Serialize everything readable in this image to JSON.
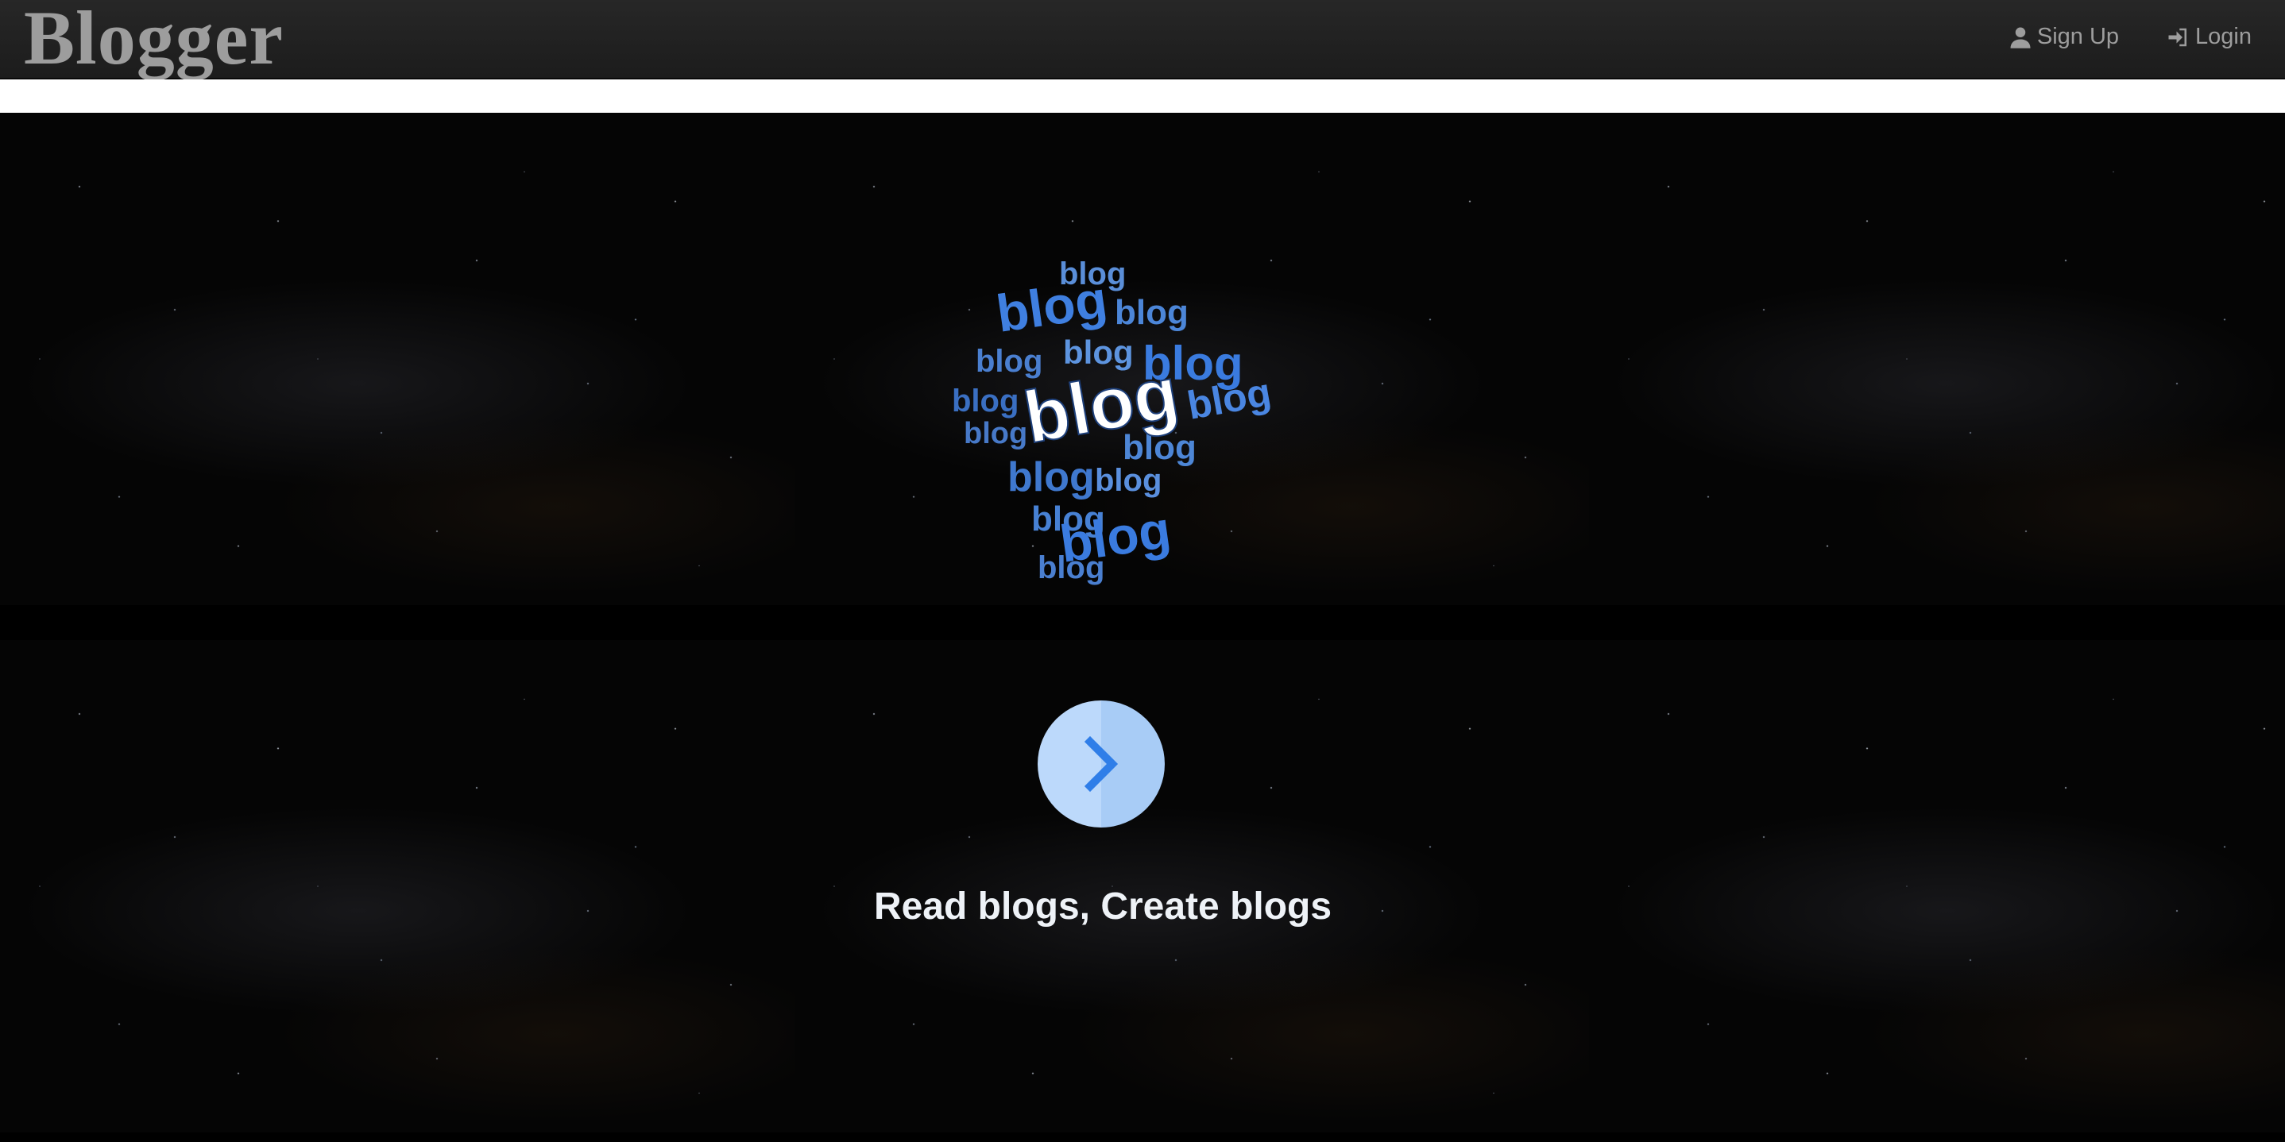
{
  "navbar": {
    "brand": "Blogger",
    "links": [
      {
        "label": "Sign Up",
        "icon": "user-icon"
      },
      {
        "label": "Login",
        "icon": "login-icon"
      }
    ]
  },
  "hero": {
    "logo_word": "blog",
    "tagline": "Read blogs, Create blogs",
    "next_icon": "chevron-right-icon"
  },
  "colors": {
    "navbar_bg": "#222222",
    "nav_text": "#9d9d9d",
    "button_fill": "#bcd9fb",
    "chevron": "#2f7ee8"
  }
}
